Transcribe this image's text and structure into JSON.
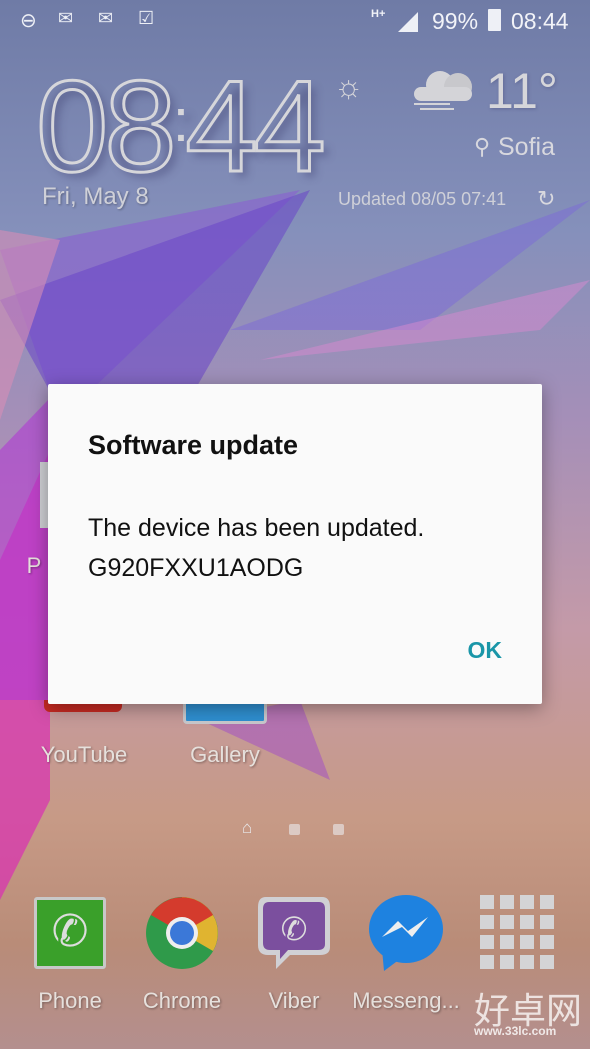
{
  "status_bar": {
    "icons": [
      "do-not-disturb-icon",
      "gmail-icon",
      "email-icon",
      "clipboard-check-icon"
    ],
    "network": "H+",
    "battery": "99%",
    "time": "08:44"
  },
  "clock_widget": {
    "hours": "08",
    "minutes": "44",
    "date": "Fri, May 8"
  },
  "weather_widget": {
    "temperature": "11°",
    "city": "Sofia",
    "updated": "Updated  08/05  07:41",
    "icon": "cloudy-fog-icon"
  },
  "dialog": {
    "title": "Software update",
    "message": "The device has been updated.",
    "build": "G920FXXU1AODG",
    "ok_label": "OK",
    "accent": "#1a96a8"
  },
  "home_apps": [
    {
      "label": "P"
    },
    {
      "label": "YouTube"
    },
    {
      "label": "Gallery"
    }
  ],
  "page_indicator": {
    "pages": 3,
    "current": "home"
  },
  "dock": [
    {
      "label": "Phone"
    },
    {
      "label": "Chrome"
    },
    {
      "label": "Viber"
    },
    {
      "label": "Messeng..."
    },
    {
      "label": "Apps"
    }
  ],
  "watermark": {
    "text": "好卓网",
    "url": "www.33lc.com"
  }
}
